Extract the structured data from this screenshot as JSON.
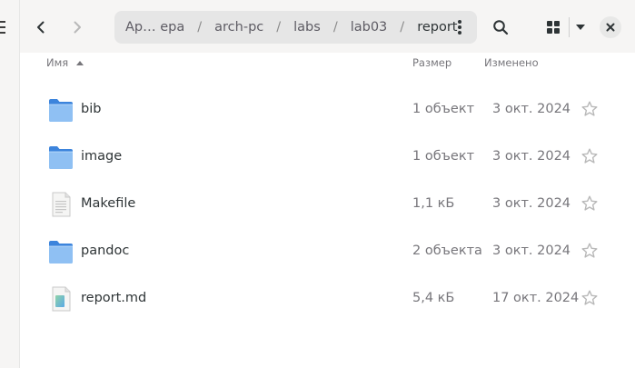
{
  "header": {
    "breadcrumb": [
      "Ар… ера",
      "arch-pc",
      "labs",
      "lab03",
      "report"
    ],
    "separator": "/"
  },
  "columns": {
    "name": "Имя",
    "size": "Размер",
    "modified": "Изменено"
  },
  "files": [
    {
      "name": "bib",
      "type": "folder-icon",
      "size": "1 объект",
      "modified": "3 окт. 2024"
    },
    {
      "name": "image",
      "type": "folder-icon",
      "size": "1 объект",
      "modified": "3 окт. 2024"
    },
    {
      "name": "Makefile",
      "type": "text-file-icon",
      "size": "1,1 кБ",
      "modified": "3 окт. 2024"
    },
    {
      "name": "pandoc",
      "type": "folder-icon",
      "size": "2 объекта",
      "modified": "3 окт. 2024"
    },
    {
      "name": "report.md",
      "type": "markdown-file-icon",
      "size": "5,4 кБ",
      "modified": "17 окт. 2024"
    }
  ],
  "colors": {
    "folder": "#62a0ea",
    "folder_dark": "#3c84dc",
    "headerbar": "#f6f5f4",
    "pathbar": "#e6e6e6"
  }
}
